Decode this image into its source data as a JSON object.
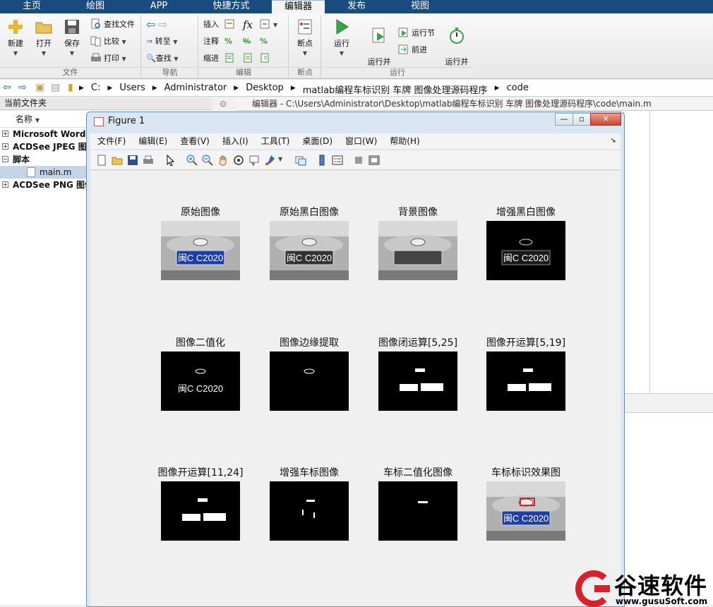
{
  "ribbon": {
    "tabs": [
      "主页",
      "绘图",
      "APP",
      "快捷方式",
      "编辑器",
      "发布",
      "视图"
    ],
    "active_tab": "编辑器",
    "file_group": {
      "title": "文件",
      "new": "新建",
      "open": "打开",
      "save": "保存",
      "find_files": "查找文件",
      "compare": "比较",
      "print": "打印"
    },
    "nav_group": {
      "title": "导航",
      "goto": "转至",
      "find": "查找"
    },
    "edit_group": {
      "title": "编辑",
      "insert": "插入",
      "comment": "注释",
      "indent": "缩进",
      "fx": "fx",
      "percent": "%"
    },
    "breakpoint_group": {
      "title": "断点",
      "breakpoints": "断点"
    },
    "run_group": {
      "title": "运行",
      "run": "运行",
      "run_advance": "运行并\n前进",
      "run_section": "运行节",
      "advance": "前进",
      "run_time": "运行并\n计时"
    }
  },
  "address": {
    "crumbs": [
      "C:",
      "Users",
      "Administrator",
      "Desktop",
      "matlab编程车标识别 车牌 图像处理源码程序",
      "code"
    ]
  },
  "file_panel": {
    "title": "当前文件夹",
    "column": "名称",
    "items": [
      "Microsoft Word 5",
      "ACDSee JPEG 图像",
      "脚本",
      "main.m",
      "ACDSee PNG 图像"
    ]
  },
  "editor": {
    "tab_title": "编辑器 - C:\\Users\\Administrator\\Desktop\\matlab编程车标识别 车牌 图像处理源码程序\\code\\main.m"
  },
  "figure": {
    "title": "Figure 1",
    "menus": [
      "文件(F)",
      "编辑(E)",
      "查看(V)",
      "插入(I)",
      "工具(T)",
      "桌面(D)",
      "窗口(W)",
      "帮助(H)"
    ],
    "subplots": [
      {
        "title": "原始图像",
        "plate": "闽C C2020"
      },
      {
        "title": "原始黑白图像",
        "plate": "闽C C2020"
      },
      {
        "title": "背景图像",
        "plate": ""
      },
      {
        "title": "增强黑白图像",
        "plate": "闽C C2020"
      },
      {
        "title": "图像二值化",
        "plate": "闽C C2020"
      },
      {
        "title": "图像边缘提取",
        "plate": ""
      },
      {
        "title": "图像闭运算[5,25]",
        "plate": ""
      },
      {
        "title": "图像开运算[5,19]",
        "plate": ""
      },
      {
        "title": "图像开运算[11,24]",
        "plate": ""
      },
      {
        "title": "增强车标图像",
        "plate": ""
      },
      {
        "title": "车标二值化图像",
        "plate": ""
      },
      {
        "title": "车标标识效果图",
        "plate": "闽C C2020"
      }
    ]
  },
  "watermark": {
    "name": "谷速软件",
    "url": "www.gusuSoft.com"
  }
}
